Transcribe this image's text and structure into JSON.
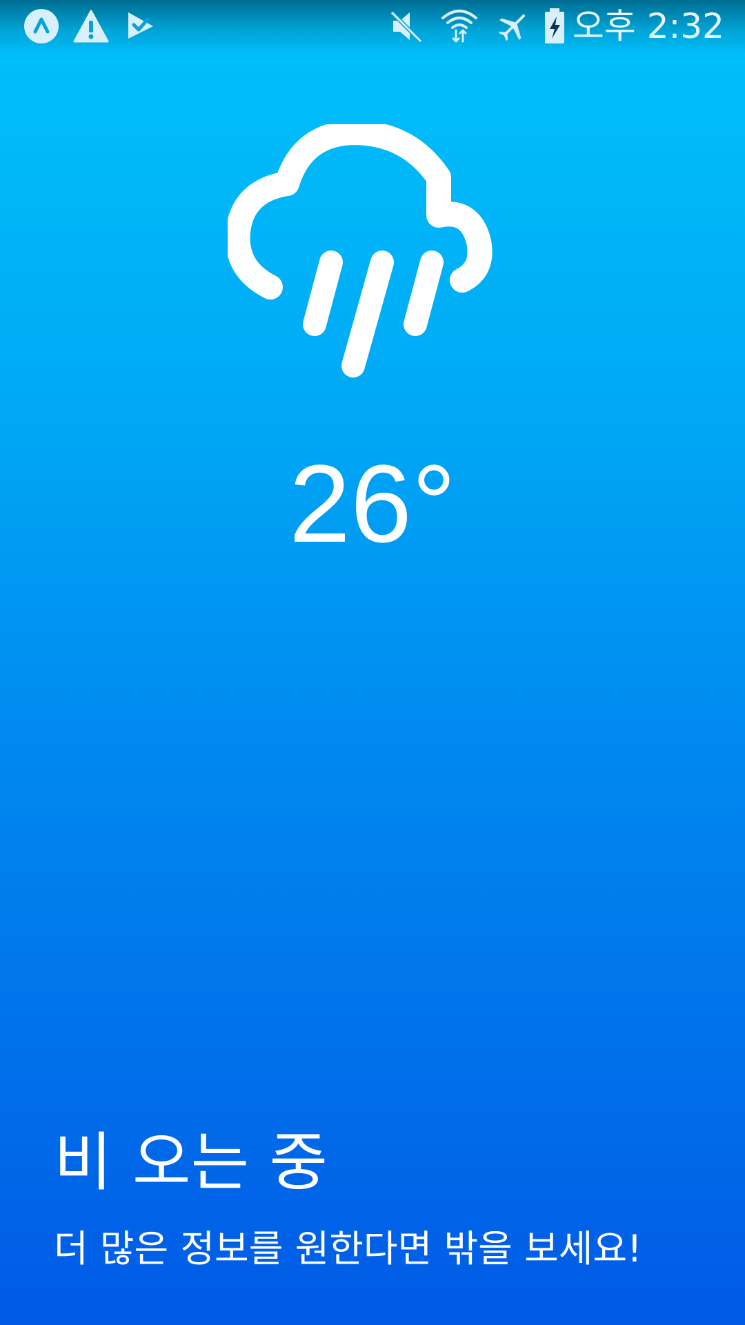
{
  "status_bar": {
    "time": "오후 2:32",
    "left_icons": [
      "app-notification-icon",
      "warning-icon",
      "download-check-icon"
    ],
    "right_icons": [
      "mute-icon",
      "wifi-icon",
      "airplane-mode-icon",
      "battery-charging-icon"
    ]
  },
  "weather": {
    "icon": "rain-cloud-icon",
    "temperature": "26°",
    "condition": "비 오는 중",
    "message": "더 많은 정보를 원한다면 밖을 보세요!"
  },
  "colors": {
    "background_top": "#00c2fb",
    "background_bottom": "#005ae6",
    "foreground": "#ffffff"
  }
}
